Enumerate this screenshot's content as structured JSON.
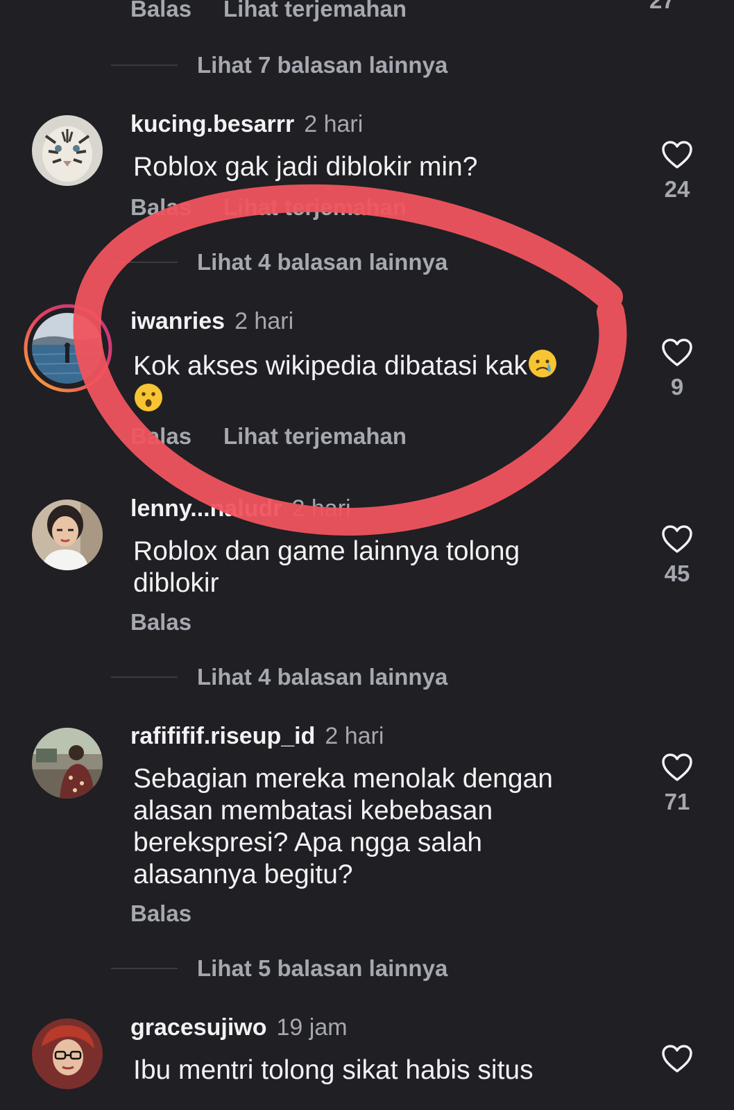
{
  "top": {
    "actions": {
      "reply": "Balas",
      "translate": "Lihat terjemahan"
    },
    "more_replies": "Lihat 7 balasan lainnya"
  },
  "comments": [
    {
      "username": "kucing.besarrr",
      "time": "2 hari",
      "text": "Roblox gak jadi diblokir min?",
      "reply": "Balas",
      "translate": "Lihat terjemahan",
      "likes": "24",
      "more_replies": "Lihat 4 balasan lainnya",
      "avatar_icon": "white-tiger-avatar"
    },
    {
      "username": "iwanries",
      "time": "2 hari",
      "text": "Kok akses wikipedia dibatasi kak",
      "emoji_1": "crying-face-emoji",
      "emoji_2": "surprised-face-emoji",
      "reply": "Balas",
      "translate": "Lihat terjemahan",
      "likes": "9",
      "avatar_icon": "lake-landscape-avatar",
      "story_ring": true
    },
    {
      "username": "lenny...naludr",
      "time": "2 hari",
      "text": "Roblox dan game lainnya tolong diblokir",
      "reply": "Balas",
      "likes": "45",
      "more_replies": "Lihat 4 balasan lainnya",
      "avatar_icon": "woman-portrait-avatar"
    },
    {
      "username": "rafififif.riseup_id",
      "time": "2 hari",
      "text": "Sebagian mereka menolak dengan alasan membatasi kebebasan berekspresi? Apa ngga salah alasannya begitu?",
      "reply": "Balas",
      "likes": "71",
      "more_replies": "Lihat 5 balasan lainnya",
      "avatar_icon": "street-scene-avatar"
    },
    {
      "username": "gracesujiwo",
      "time": "19 jam",
      "text": "Ibu mentri tolong sikat habis situs",
      "avatar_icon": "woman-glasses-avatar"
    }
  ],
  "colors": {
    "background": "#1f1f24",
    "primary_text": "#f2f2f4",
    "secondary_text": "#a6a8b0",
    "annotation_circle": "#f0545e"
  },
  "icons": {
    "like": "heart-outline-icon"
  }
}
